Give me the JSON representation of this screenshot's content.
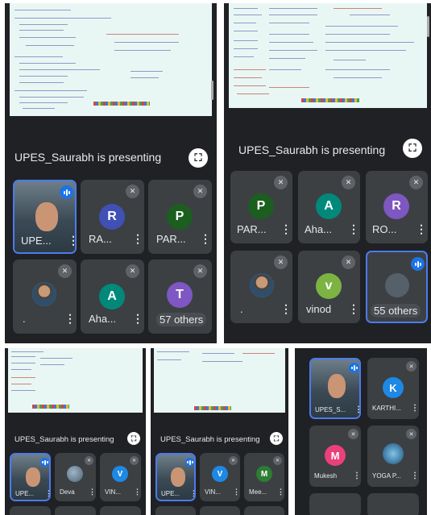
{
  "panel_a": {
    "presenting": "UPES_Saurabh is presenting",
    "tiles": [
      {
        "name": "UPE...",
        "initial": "",
        "color": "",
        "state": "speaking"
      },
      {
        "name": "RA...",
        "initial": "R",
        "color": "#3f51b5",
        "state": "muted"
      },
      {
        "name": "PAR...",
        "initial": "P",
        "color": "#1b5e20",
        "state": "muted"
      },
      {
        "name": ".",
        "initial": "",
        "color": "",
        "state": "muted"
      },
      {
        "name": "Aha...",
        "initial": "A",
        "color": "#00897b",
        "state": "muted"
      },
      {
        "name": "57 others",
        "initial": "T",
        "color": "#7e57c2",
        "state": "muted"
      }
    ]
  },
  "panel_b": {
    "presenting": "UPES_Saurabh is presenting",
    "tiles": [
      {
        "name": "PAR...",
        "initial": "P",
        "color": "#1b5e20",
        "state": "muted"
      },
      {
        "name": "Aha...",
        "initial": "A",
        "color": "#00897b",
        "state": "muted"
      },
      {
        "name": "RO...",
        "initial": "R",
        "color": "#7e57c2",
        "state": "muted"
      },
      {
        "name": ".",
        "initial": "",
        "color": "",
        "state": "muted"
      },
      {
        "name": "vinod",
        "initial": "v",
        "color": "#7cb342",
        "state": "muted"
      },
      {
        "name": "55 others",
        "initial": "",
        "color": "",
        "state": "speaking"
      }
    ]
  },
  "panel_c": {
    "presenting": "UPES_Saurabh is presenting",
    "tiles": [
      {
        "name": "UPE...",
        "initial": "",
        "color": "",
        "state": "speaking"
      },
      {
        "name": "Deva",
        "initial": "",
        "color": "",
        "state": "muted"
      },
      {
        "name": "VIN...",
        "initial": "V",
        "color": "#1e88e5",
        "state": "muted"
      }
    ]
  },
  "panel_d": {
    "presenting": "UPES_Saurabh is presenting",
    "tiles": [
      {
        "name": "UPE...",
        "initial": "",
        "color": "",
        "state": "speaking"
      },
      {
        "name": "VIN...",
        "initial": "V",
        "color": "#1e88e5",
        "state": "muted"
      },
      {
        "name": "Mee...",
        "initial": "M",
        "color": "#2e7d32",
        "state": "muted"
      }
    ]
  },
  "panel_e": {
    "tiles": [
      {
        "name": "UPES_S...",
        "initial": "",
        "color": "",
        "state": "speaking"
      },
      {
        "name": "KARTHI...",
        "initial": "K",
        "color": "#1e88e5",
        "state": "muted"
      },
      {
        "name": "Mukesh",
        "initial": "M",
        "color": "#ec407a",
        "state": "muted"
      },
      {
        "name": "YOGA P...",
        "initial": "",
        "color": "",
        "state": "muted"
      }
    ]
  },
  "icons": {
    "more": "⋮",
    "mic_off": "🎙",
    "fullscreen": "⛶"
  }
}
